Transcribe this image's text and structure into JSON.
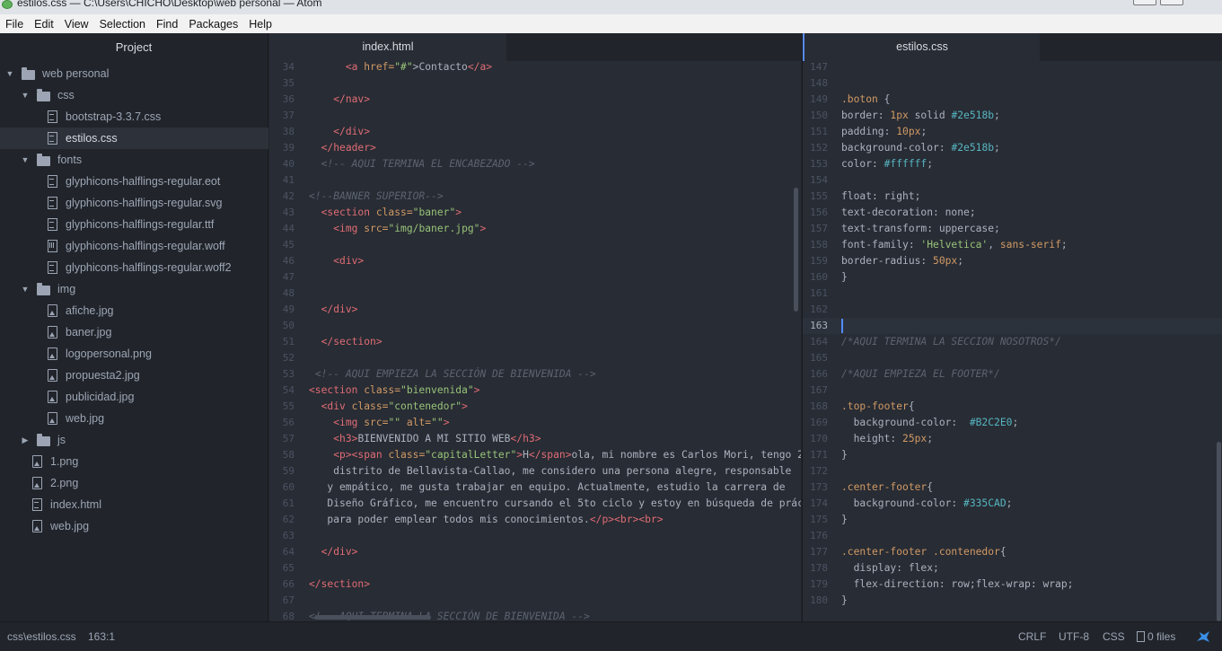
{
  "window": {
    "title": "estilos.css — C:\\Users\\CHICHO\\Desktop\\web personal — Atom"
  },
  "menu": [
    "File",
    "Edit",
    "View",
    "Selection",
    "Find",
    "Packages",
    "Help"
  ],
  "tree": {
    "title": "Project",
    "items": [
      {
        "label": "web personal",
        "kind": "folder",
        "depth": 0,
        "open": true
      },
      {
        "label": "css",
        "kind": "folder",
        "depth": 1,
        "open": true
      },
      {
        "label": "bootstrap-3.3.7.css",
        "kind": "text",
        "depth": 2
      },
      {
        "label": "estilos.css",
        "kind": "text",
        "depth": 2,
        "selected": true
      },
      {
        "label": "fonts",
        "kind": "folder",
        "depth": 1,
        "open": true
      },
      {
        "label": "glyphicons-halflings-regular.eot",
        "kind": "text",
        "depth": 2
      },
      {
        "label": "glyphicons-halflings-regular.svg",
        "kind": "text",
        "depth": 2
      },
      {
        "label": "glyphicons-halflings-regular.ttf",
        "kind": "text",
        "depth": 2
      },
      {
        "label": "glyphicons-halflings-regular.woff",
        "kind": "bin",
        "depth": 2
      },
      {
        "label": "glyphicons-halflings-regular.woff2",
        "kind": "text",
        "depth": 2
      },
      {
        "label": "img",
        "kind": "folder",
        "depth": 1,
        "open": true
      },
      {
        "label": "afiche.jpg",
        "kind": "img",
        "depth": 2
      },
      {
        "label": "baner.jpg",
        "kind": "img",
        "depth": 2
      },
      {
        "label": "logopersonal.png",
        "kind": "img",
        "depth": 2
      },
      {
        "label": "propuesta2.jpg",
        "kind": "img",
        "depth": 2
      },
      {
        "label": "publicidad.jpg",
        "kind": "img",
        "depth": 2
      },
      {
        "label": "web.jpg",
        "kind": "img",
        "depth": 2
      },
      {
        "label": "js",
        "kind": "folder",
        "depth": 1,
        "open": false
      },
      {
        "label": "1.png",
        "kind": "img",
        "depth": 1
      },
      {
        "label": "2.png",
        "kind": "img",
        "depth": 1
      },
      {
        "label": "index.html",
        "kind": "text",
        "depth": 1
      },
      {
        "label": "web.jpg",
        "kind": "img",
        "depth": 1
      }
    ]
  },
  "left_editor": {
    "tab": "index.html",
    "first_line": 34,
    "lines": [
      [
        [
          "      ",
          "p"
        ],
        [
          "<a ",
          "tag"
        ],
        [
          "href=",
          "attr"
        ],
        [
          "\"#\"",
          "str"
        ],
        [
          ">Contacto",
          "p"
        ],
        [
          "</a>",
          "tag"
        ]
      ],
      [],
      [
        [
          "    ",
          "p"
        ],
        [
          "</nav>",
          "tag"
        ]
      ],
      [],
      [
        [
          "    ",
          "p"
        ],
        [
          "</div>",
          "tag"
        ]
      ],
      [
        [
          "  ",
          "p"
        ],
        [
          "</header>",
          "tag"
        ]
      ],
      [
        [
          "  ",
          "p"
        ],
        [
          "<!-- AQUI TERMINA EL ENCABEZADO -->",
          "com"
        ]
      ],
      [],
      [
        [
          "<!--BANNER SUPERIOR-->",
          "com"
        ]
      ],
      [
        [
          "  ",
          "p"
        ],
        [
          "<section ",
          "tag"
        ],
        [
          "class=",
          "attr"
        ],
        [
          "\"baner\"",
          "str"
        ],
        [
          ">",
          "tag"
        ]
      ],
      [
        [
          "    ",
          "p"
        ],
        [
          "<img ",
          "tag"
        ],
        [
          "src=",
          "attr"
        ],
        [
          "\"img/baner.jpg\"",
          "str"
        ],
        [
          ">",
          "tag"
        ]
      ],
      [],
      [
        [
          "    ",
          "p"
        ],
        [
          "<div>",
          "tag"
        ]
      ],
      [],
      [],
      [
        [
          "  ",
          "p"
        ],
        [
          "</div>",
          "tag"
        ]
      ],
      [],
      [
        [
          "  ",
          "p"
        ],
        [
          "</section>",
          "tag"
        ]
      ],
      [],
      [
        [
          " ",
          "p"
        ],
        [
          "<!-- AQUI EMPIEZA LA SECCIÓN DE BIENVENIDA -->",
          "com"
        ]
      ],
      [
        [
          "",
          "p"
        ],
        [
          "<section ",
          "tag"
        ],
        [
          "class=",
          "attr"
        ],
        [
          "\"bienvenida\"",
          "str"
        ],
        [
          ">",
          "tag"
        ]
      ],
      [
        [
          "  ",
          "p"
        ],
        [
          "<div ",
          "tag"
        ],
        [
          "class=",
          "attr"
        ],
        [
          "\"contenedor\"",
          "str"
        ],
        [
          ">",
          "tag"
        ]
      ],
      [
        [
          "    ",
          "p"
        ],
        [
          "<img ",
          "tag"
        ],
        [
          "src=",
          "attr"
        ],
        [
          "\"\" ",
          "str"
        ],
        [
          "alt=",
          "attr"
        ],
        [
          "\"\"",
          "str"
        ],
        [
          ">",
          "tag"
        ]
      ],
      [
        [
          "    ",
          "p"
        ],
        [
          "<h3>",
          "tag"
        ],
        [
          "BIENVENIDO A MI SITIO WEB",
          "p"
        ],
        [
          "</h3>",
          "tag"
        ]
      ],
      [
        [
          "    ",
          "p"
        ],
        [
          "<p>",
          "tag"
        ],
        [
          "<span ",
          "tag"
        ],
        [
          "class=",
          "attr"
        ],
        [
          "\"capitalLetter\"",
          "str"
        ],
        [
          ">",
          "tag"
        ],
        [
          "H",
          "p"
        ],
        [
          "</span>",
          "tag"
        ],
        [
          "ola, mi nombre es Carlos Mori, tengo 2",
          "p"
        ]
      ],
      [
        [
          "    distrito de Bellavista-Callao, me considero una persona alegre, responsable",
          "p"
        ]
      ],
      [
        [
          "   y empático, me gusta trabajar en equipo. Actualmente, estudio la carrera de",
          "p"
        ]
      ],
      [
        [
          "   Diseño Gráfico, me encuentro cursando el 5to ciclo y estoy en búsqueda de prác",
          "p"
        ]
      ],
      [
        [
          "   para poder emplear todos mis conocimientos.",
          "p"
        ],
        [
          "</p>",
          "tag"
        ],
        [
          "<br>",
          "tag"
        ],
        [
          "<br>",
          "tag"
        ]
      ],
      [],
      [
        [
          "  ",
          "p"
        ],
        [
          "</div>",
          "tag"
        ]
      ],
      [],
      [
        [
          "",
          "p"
        ],
        [
          "</section>",
          "tag"
        ]
      ],
      [],
      [
        [
          "",
          "p"
        ],
        [
          "<!-- AQUI TERMINA LA SECCIÓN DE BIENVENIDA -->",
          "com"
        ]
      ]
    ]
  },
  "right_editor": {
    "tab": "estilos.css",
    "first_line": 147,
    "cursor_line": 163,
    "lines": [
      [],
      [],
      [
        [
          ".boton",
          "sel"
        ],
        [
          " {",
          "p"
        ]
      ],
      [
        [
          "border: ",
          "p"
        ],
        [
          "1px",
          "num"
        ],
        [
          " solid ",
          "p"
        ],
        [
          "#2e518b",
          "hex"
        ],
        [
          ";",
          "p"
        ]
      ],
      [
        [
          "padding: ",
          "p"
        ],
        [
          "10px",
          "num"
        ],
        [
          ";",
          "p"
        ]
      ],
      [
        [
          "background-color: ",
          "p"
        ],
        [
          "#2e518b",
          "hex"
        ],
        [
          ";",
          "p"
        ]
      ],
      [
        [
          "color: ",
          "p"
        ],
        [
          "#ffffff",
          "hex"
        ],
        [
          ";",
          "p"
        ]
      ],
      [],
      [
        [
          "float: right;",
          "p"
        ]
      ],
      [
        [
          "text-decoration: none;",
          "p"
        ]
      ],
      [
        [
          "text-transform: uppercase;",
          "p"
        ]
      ],
      [
        [
          "font-family: ",
          "p"
        ],
        [
          "'Helvetica'",
          "str"
        ],
        [
          ", ",
          "p"
        ],
        [
          "sans-serif",
          "num"
        ],
        [
          ";",
          "p"
        ]
      ],
      [
        [
          "border-radius: ",
          "p"
        ],
        [
          "50px",
          "num"
        ],
        [
          ";",
          "p"
        ]
      ],
      [
        [
          "}",
          "p"
        ]
      ],
      [],
      [],
      [],
      [
        [
          "/*AQUI TERMINA LA SECCION NOSOTROS*/",
          "com"
        ]
      ],
      [],
      [
        [
          "/*AQUI EMPIEZA EL FOOTER*/",
          "com"
        ]
      ],
      [],
      [
        [
          ".top-footer",
          "sel"
        ],
        [
          "{",
          "p"
        ]
      ],
      [
        [
          "  background-color:  ",
          "p"
        ],
        [
          "#B2C2E0",
          "hex"
        ],
        [
          ";",
          "p"
        ]
      ],
      [
        [
          "  height: ",
          "p"
        ],
        [
          "25px",
          "num"
        ],
        [
          ";",
          "p"
        ]
      ],
      [
        [
          "}",
          "p"
        ]
      ],
      [],
      [
        [
          ".center-footer",
          "sel"
        ],
        [
          "{",
          "p"
        ]
      ],
      [
        [
          "  background-color: ",
          "p"
        ],
        [
          "#335CAD",
          "hex"
        ],
        [
          ";",
          "p"
        ]
      ],
      [
        [
          "}",
          "p"
        ]
      ],
      [],
      [
        [
          ".center-footer .contenedor",
          "sel"
        ],
        [
          "{",
          "p"
        ]
      ],
      [
        [
          "  display: flex;",
          "p"
        ]
      ],
      [
        [
          "  flex-direction: row;flex-wrap: wrap;",
          "p"
        ]
      ],
      [
        [
          "}",
          "p"
        ]
      ]
    ]
  },
  "status": {
    "file": "css\\estilos.css",
    "position": "163:1",
    "line_ending": "CRLF",
    "encoding": "UTF-8",
    "grammar": "CSS",
    "files": "0 files"
  }
}
